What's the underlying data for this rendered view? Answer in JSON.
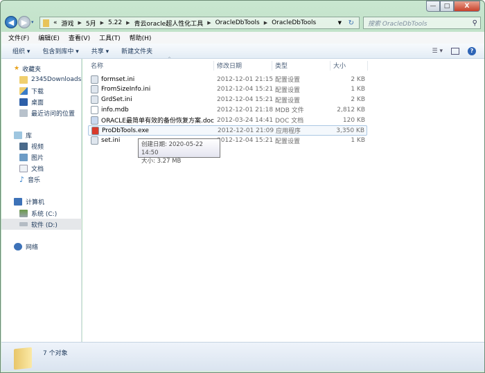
{
  "window": {
    "minimize": "—",
    "maximize": "□",
    "close": "X"
  },
  "address": {
    "overflow": "«",
    "crumbs": [
      "游戏",
      "5月",
      "5.22",
      "青云oracle超人性化工具",
      "OracleDbTools",
      "OracleDbTools"
    ]
  },
  "search": {
    "placeholder": "搜索 OracleDbTools"
  },
  "menu": [
    "文件(F)",
    "编辑(E)",
    "查看(V)",
    "工具(T)",
    "帮助(H)"
  ],
  "toolbar": {
    "organize": "组织 ▾",
    "include": "包含到库中 ▾",
    "share": "共享 ▾",
    "new_folder": "新建文件夹"
  },
  "sidebar": {
    "favorites": {
      "label": "收藏夹",
      "items": [
        "2345Downloads",
        "下载",
        "桌面",
        "最近访问的位置"
      ]
    },
    "libraries": {
      "label": "库",
      "items": [
        "视频",
        "图片",
        "文档",
        "音乐"
      ]
    },
    "computer": {
      "label": "计算机",
      "items": [
        "系统 (C:)",
        "软件 (D:)"
      ]
    },
    "network": {
      "label": "网络"
    }
  },
  "columns": {
    "name": "名称",
    "date": "修改日期",
    "type": "类型",
    "size": "大小"
  },
  "files": [
    {
      "name": "formset.ini",
      "date": "2012-12-01 21:15",
      "type": "配置设置",
      "size": "2 KB"
    },
    {
      "name": "FromSizeInfo.ini",
      "date": "2012-12-04 15:21",
      "type": "配置设置",
      "size": "1 KB"
    },
    {
      "name": "GrdSet.ini",
      "date": "2012-12-04 15:21",
      "type": "配置设置",
      "size": "2 KB"
    },
    {
      "name": "info.mdb",
      "date": "2012-12-01 21:18",
      "type": "MDB 文件",
      "size": "2,812 KB"
    },
    {
      "name": "ORACLE最简单有效的备份恢复方案.doc",
      "date": "2012-03-24 14:41",
      "type": "DOC 文档",
      "size": "120 KB"
    },
    {
      "name": "ProDbTools.exe",
      "date": "2012-12-01 21:09",
      "type": "应用程序",
      "size": "3,350 KB"
    },
    {
      "name": "set.ini",
      "date": "2012-12-04 15:21",
      "type": "配置设置",
      "size": "1 KB"
    }
  ],
  "tooltip": {
    "created": "创建日期: 2020-05-22 14:50",
    "size": "大小: 3.27 MB"
  },
  "status": {
    "count": "7 个对象"
  }
}
